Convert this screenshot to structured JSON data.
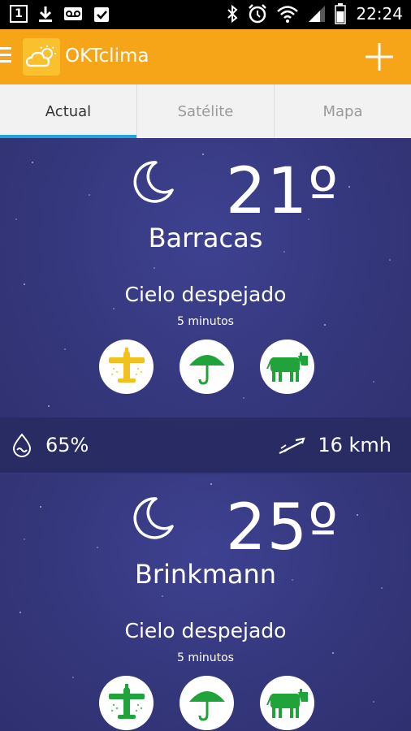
{
  "status_bar": {
    "notification_count": "1",
    "time": "22:24"
  },
  "app": {
    "title": "OKTclima"
  },
  "tabs": [
    {
      "label": "Actual",
      "active": true
    },
    {
      "label": "Satélite",
      "active": false
    },
    {
      "label": "Mapa",
      "active": false
    }
  ],
  "cards": [
    {
      "temperature": "21º",
      "city": "Barracas",
      "condition": "Cielo despejado",
      "updated": "5 minutos",
      "icons": [
        {
          "name": "airplane-icon",
          "color": "#f2c11f"
        },
        {
          "name": "umbrella-icon",
          "color": "#1fa33a"
        },
        {
          "name": "cow-icon",
          "color": "#1fa33a"
        }
      ],
      "humidity": "65%",
      "wind": "16 kmh"
    },
    {
      "temperature": "25º",
      "city": "Brinkmann",
      "condition": "Cielo despejado",
      "updated": "5 minutos",
      "icons": [
        {
          "name": "airplane-icon",
          "color": "#1fa33a"
        },
        {
          "name": "umbrella-icon",
          "color": "#1fa33a"
        },
        {
          "name": "cow-icon",
          "color": "#1fa33a"
        }
      ]
    }
  ],
  "colors": {
    "app_bar": "#f6a418",
    "tab_indicator": "#24a4d8",
    "background": "#35377a",
    "good": "#1fa33a",
    "warning": "#f2c11f"
  }
}
